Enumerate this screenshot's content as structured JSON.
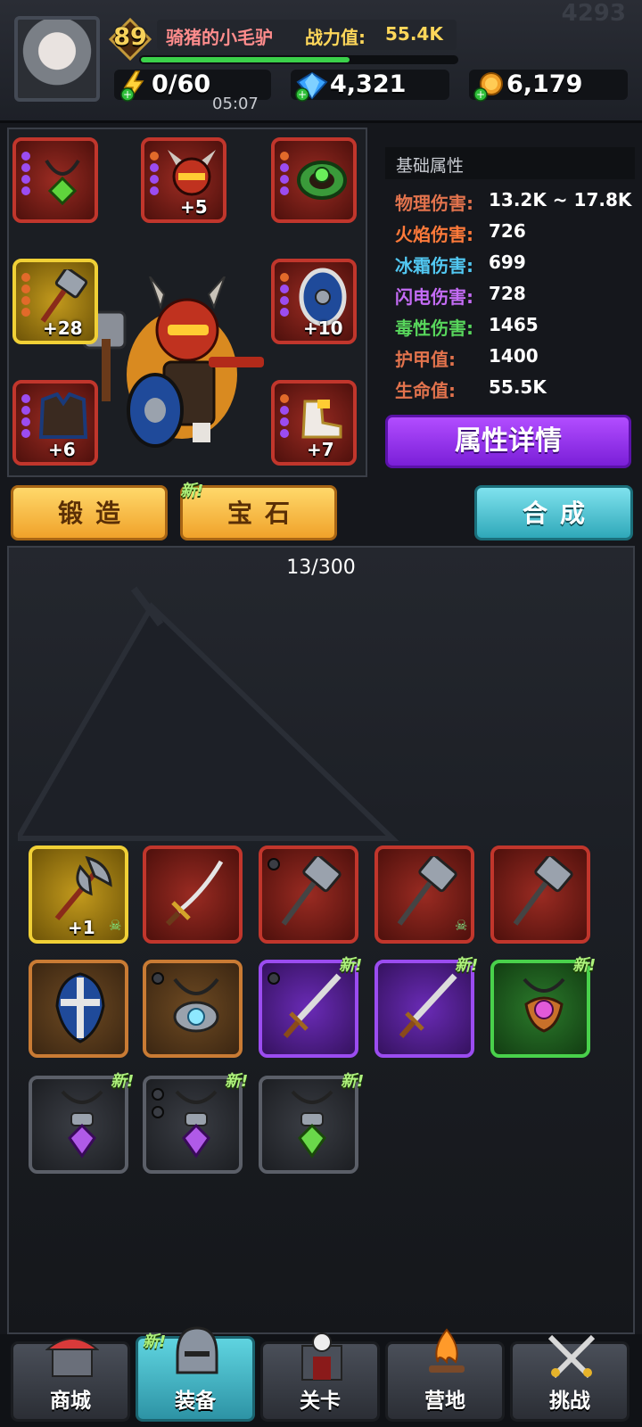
{
  "top": {
    "level": "89",
    "player_name": "骑猪的小毛驴",
    "power_label": "战力值:",
    "power_value": "55.4K",
    "ghost_number": "4293",
    "xp_fraction": 0.66,
    "energy": "0/60",
    "energy_timer": "05:07",
    "diamonds": "4,321",
    "gold": "6,179"
  },
  "stats": {
    "header": "基础属性",
    "rows": [
      {
        "label": "物理伤害:",
        "value": "13.2K ~ 17.8K",
        "color": "#e2734d"
      },
      {
        "label": "火焰伤害:",
        "value": "726",
        "color": "#ff7a3a"
      },
      {
        "label": "冰霜伤害:",
        "value": "699",
        "color": "#52c8f2"
      },
      {
        "label": "闪电伤害:",
        "value": "728",
        "color": "#c46cf5"
      },
      {
        "label": "毒性伤害:",
        "value": "1465",
        "color": "#58d65c"
      },
      {
        "label": "护甲值:",
        "value": "1400",
        "color": "#e2734d"
      },
      {
        "label": "生命值:",
        "value": "55.5K",
        "color": "#e2734d"
      }
    ],
    "detail_button": "属性详情"
  },
  "equipped": {
    "helmet_plus": "+5",
    "weapon_plus": "+28",
    "shield_plus": "+10",
    "armor_plus": "+6",
    "boots_plus": "+7"
  },
  "actions": {
    "forge": "锻造",
    "gem": "宝石",
    "gem_new": "新!",
    "synth": "合成"
  },
  "inventory": {
    "count": "13/300",
    "axe_plus": "+1",
    "new_tag": "新!"
  },
  "nav": {
    "shop": "商城",
    "equip": "装备",
    "equip_new": "新!",
    "stage": "关卡",
    "camp": "营地",
    "challenge": "挑战"
  }
}
